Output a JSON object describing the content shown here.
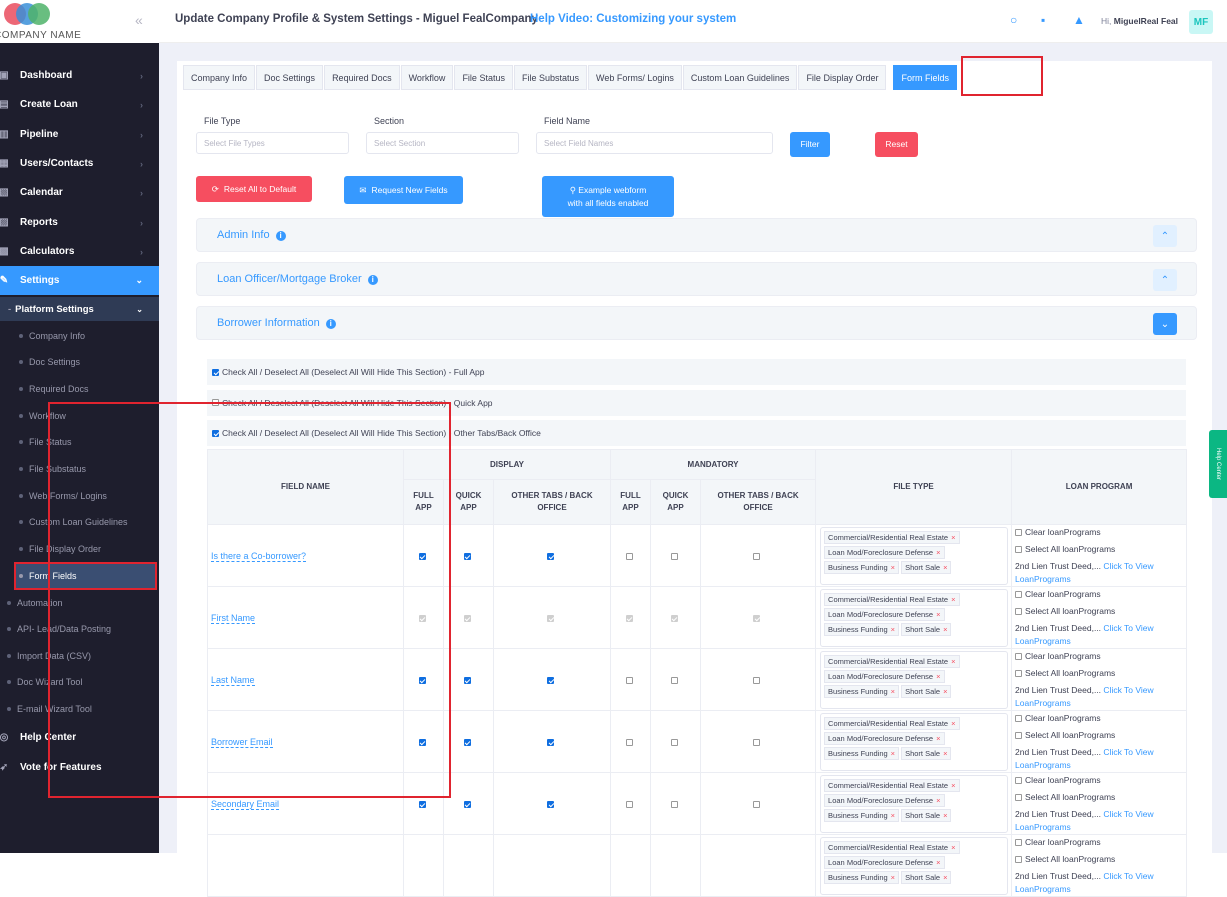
{
  "brand": {
    "logo_text": "COMPANY NAME",
    "colors": [
      "#e94c5e",
      "#3a8fd8",
      "#4fb36a"
    ]
  },
  "topbar": {
    "title": "Update Company Profile & System Settings - Miguel FealCompany",
    "help_video": "Help Video: Customizing your system",
    "greeting_prefix": "Hi,",
    "user_name": "MiguelReal Feal",
    "avatar": "MF"
  },
  "sidebar": {
    "items": [
      {
        "label": "Dashboard",
        "icon": "dashboard-icon"
      },
      {
        "label": "Create Loan",
        "icon": "create-loan-icon"
      },
      {
        "label": "Pipeline",
        "icon": "pipeline-icon"
      },
      {
        "label": "Users/Contacts",
        "icon": "users-icon"
      },
      {
        "label": "Calendar",
        "icon": "calendar-icon"
      },
      {
        "label": "Reports",
        "icon": "reports-icon"
      },
      {
        "label": "Calculators",
        "icon": "calculator-icon"
      },
      {
        "label": "Settings",
        "icon": "wrench-icon"
      }
    ],
    "platform_settings": "Platform Settings",
    "platform_sub": [
      "Company Info",
      "Doc Settings",
      "Required Docs",
      "Workflow",
      "File Status",
      "File Substatus",
      "Web Forms/ Logins",
      "Custom Loan Guidelines",
      "File Display Order",
      "Form Fields"
    ],
    "settings_sub": [
      "Automation",
      "API- Lead/Data Posting",
      "Import Data (CSV)",
      "Doc Wizard Tool",
      "E-mail Wizard Tool"
    ],
    "help_center": "Help Center",
    "vote": "Vote for Features"
  },
  "tabs": [
    "Company Info",
    "Doc Settings",
    "Required Docs",
    "Workflow",
    "File Status",
    "File Substatus",
    "Web Forms/ Logins",
    "Custom Loan Guidelines",
    "File Display Order",
    "Form Fields"
  ],
  "filters": {
    "file_type_label": "File Type",
    "file_type_placeholder": "Select File Types",
    "section_label": "Section",
    "section_placeholder": "Select Section",
    "field_name_label": "Field Name",
    "field_name_placeholder": "Select Field Names",
    "filter_btn": "Filter",
    "reset_btn": "Reset"
  },
  "actions": {
    "reset_all": "Reset All to Default",
    "request_new": "Request New Fields",
    "example_line1": "Example webform",
    "example_line2": "with all fields enabled"
  },
  "sections": [
    "Admin Info",
    "Loan Officer/Mortgage Broker",
    "Borrower Information"
  ],
  "check_rows": [
    {
      "label": "Check All / Deselect All (Deselect All Will Hide This Section) - Full App",
      "checked": true
    },
    {
      "label": "Check All / Deselect All (Deselect All Will Hide This Section) - Quick App",
      "checked": false
    },
    {
      "label": "Check All / Deselect All (Deselect All Will Hide This Section) - Other Tabs/Back Office",
      "checked": true
    }
  ],
  "table": {
    "headers": {
      "field_name": "FIELD NAME",
      "display": "DISPLAY",
      "mandatory": "MANDATORY",
      "file_type": "FILE TYPE",
      "loan_program": "LOAN PROGRAM",
      "full_app": [
        "FULL",
        "APP"
      ],
      "quick_app": [
        "QUICK",
        "APP"
      ],
      "other": [
        "OTHER TABS / BACK",
        "OFFICE"
      ]
    },
    "file_type_tags": [
      "Commercial/Residential Real Estate",
      "Loan Mod/Foreclosure Defense",
      "Business Funding",
      "Short Sale"
    ],
    "loan_program": {
      "clear": "Clear loanPrograms",
      "select_all": "Select All loanPrograms",
      "deed": "2nd Lien Trust Deed,...",
      "click": "Click To View",
      "programs": "LoanPrograms"
    },
    "rows": [
      {
        "name": "Is there a Co-borrower?",
        "state": "on"
      },
      {
        "name": "First Name",
        "state": "dis"
      },
      {
        "name": "Last Name",
        "state": "on"
      },
      {
        "name": "Borrower Email",
        "state": "on"
      },
      {
        "name": "Secondary Email",
        "state": "on"
      },
      {
        "name": "",
        "state": "none"
      }
    ]
  },
  "help_tab": "Help Center"
}
